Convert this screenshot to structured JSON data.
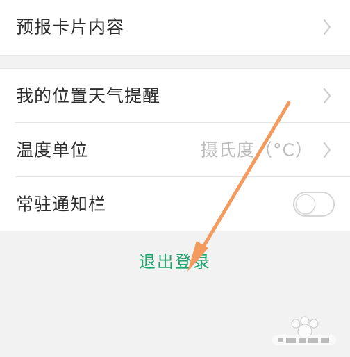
{
  "settings": {
    "top_item": {
      "label": "预报卡片内容",
      "icon": "chevron-right-icon"
    },
    "items": [
      {
        "label": "我的位置天气提醒",
        "icon": "chevron-right-icon"
      },
      {
        "label": "温度单位",
        "value": "摄氏度（°C）",
        "icon": "chevron-right-icon"
      },
      {
        "label": "常驻通知栏",
        "toggle_state": "off",
        "toggle_icon": "toggle-switch-icon"
      }
    ]
  },
  "action": {
    "logout_label": "退出登录"
  },
  "overlay": {
    "arrow_icon": "orange-arrow-icon",
    "watermark_icon": "baidu-jingyan-watermark-icon"
  },
  "colors": {
    "page_background": "#f2f2f2",
    "card_background": "#ffffff",
    "primary_text": "#2e2e2e",
    "secondary_text": "#bdbdbd",
    "accent_green": "#1fa56d",
    "arrow_orange": "#f39b5e",
    "divider": "#e5e5e5"
  }
}
